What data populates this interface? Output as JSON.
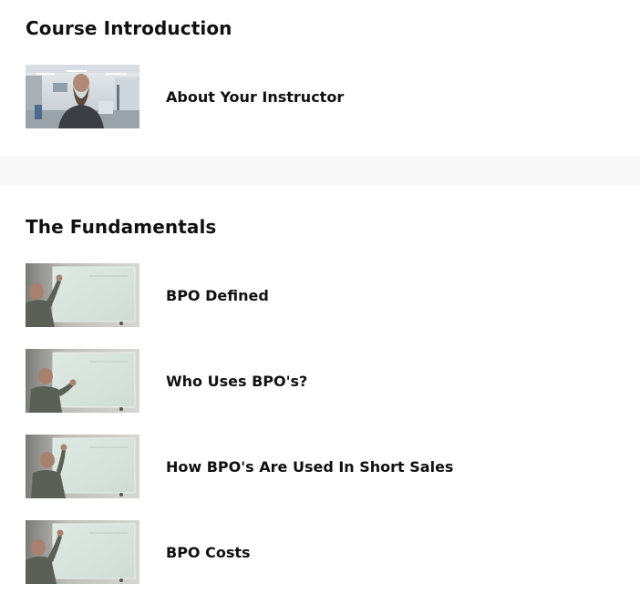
{
  "sections": [
    {
      "title": "Course Introduction",
      "lessons": [
        {
          "title": "About Your Instructor",
          "thumbnail": "instructor-portrait-video"
        }
      ]
    },
    {
      "title": "The Fundamentals",
      "lessons": [
        {
          "title": "BPO Defined",
          "thumbnail": "whiteboard-video"
        },
        {
          "title": "Who Uses BPO's?",
          "thumbnail": "whiteboard-video"
        },
        {
          "title": "How BPO's Are Used In Short Sales",
          "thumbnail": "whiteboard-video"
        },
        {
          "title": "BPO Costs",
          "thumbnail": "whiteboard-video"
        }
      ]
    }
  ],
  "colors": {
    "page_background": "#f8f8f8",
    "card_background": "#ffffff",
    "text": "#111111"
  }
}
